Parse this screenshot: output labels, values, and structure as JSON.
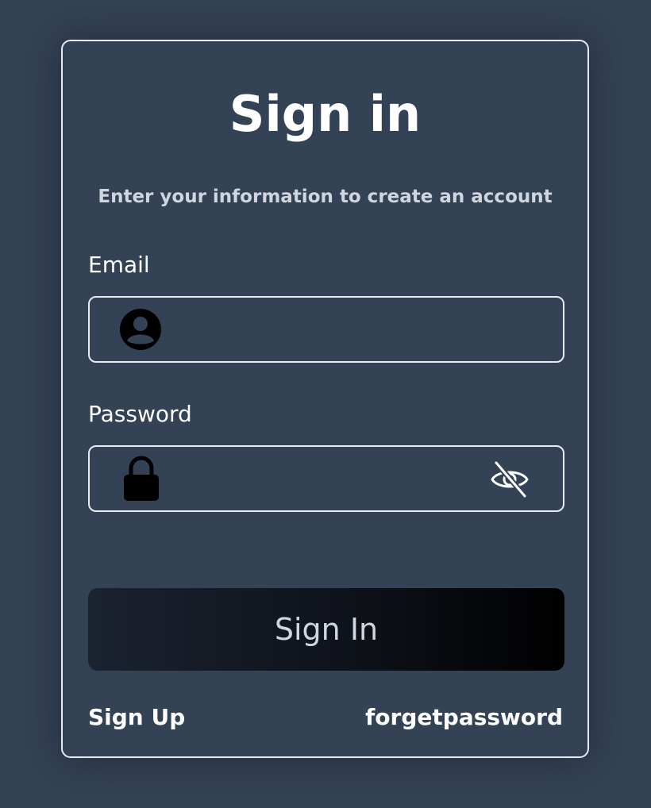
{
  "signin": {
    "title": "Sign in",
    "subtitle": "Enter your information to create an account",
    "email": {
      "label": "Email",
      "value": "",
      "placeholder": "",
      "icon": "user-icon"
    },
    "password": {
      "label": "Password",
      "value": "",
      "placeholder": "",
      "icon": "lock-icon",
      "toggle_icon": "eye-off-icon"
    },
    "submit_label": "Sign In",
    "signup_label": "Sign Up",
    "forgot_label": "forgetpassword"
  },
  "colors": {
    "background": "#344256",
    "card_border": "#e6ebf2",
    "text": "#ffffff",
    "subtitle_text": "#cfd6df",
    "button_start": "#1b2230",
    "button_end": "#000000"
  }
}
